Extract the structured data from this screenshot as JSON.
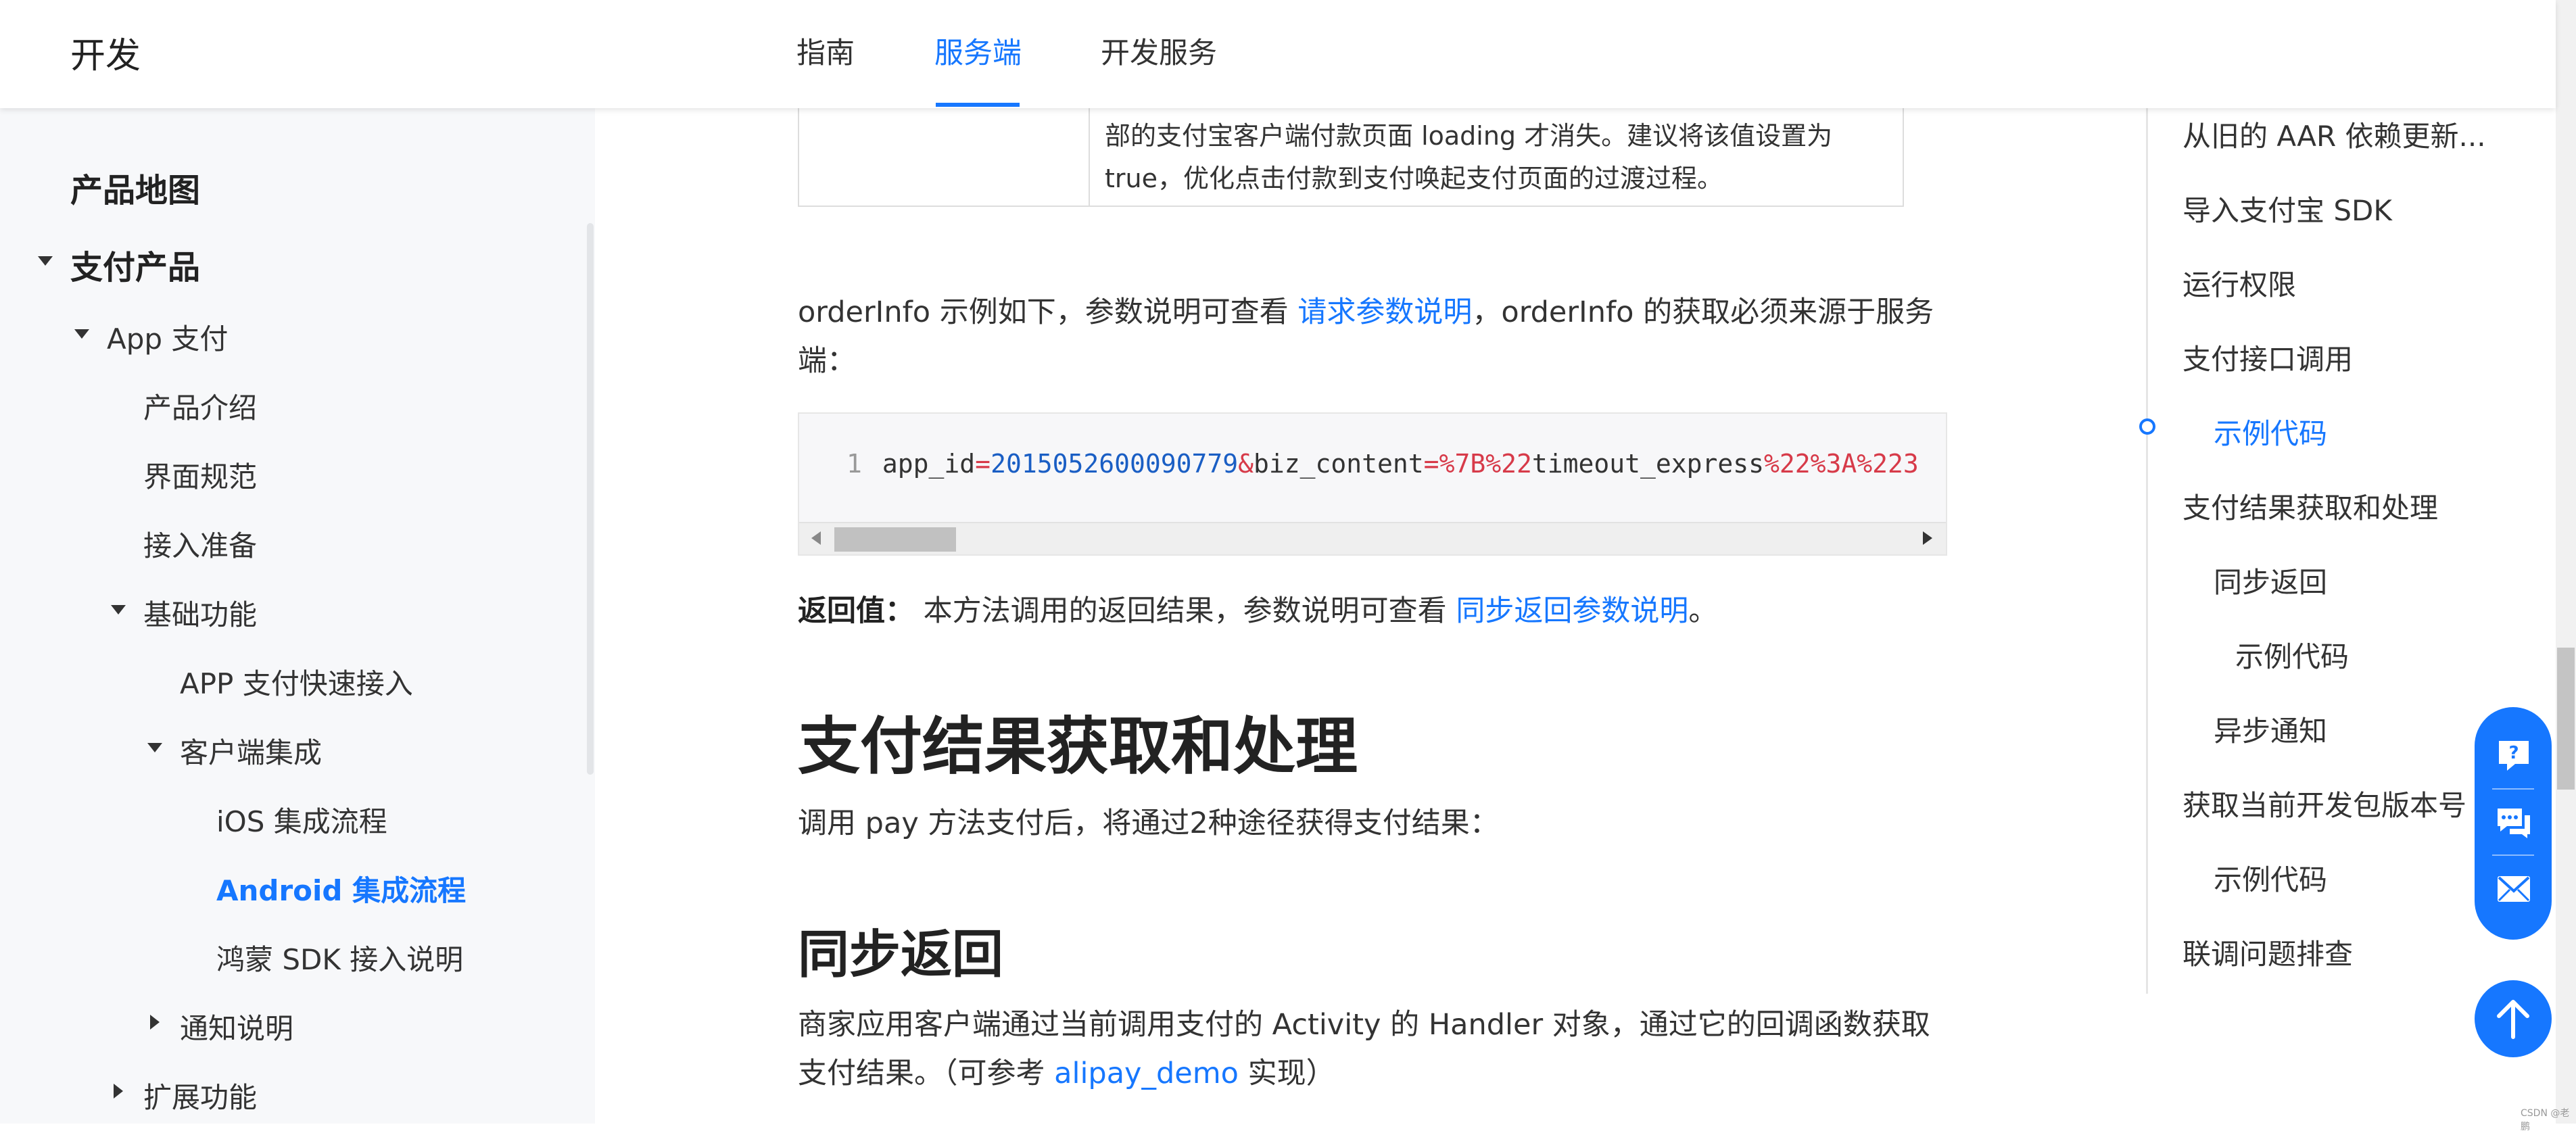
{
  "header": {
    "brand": "开发",
    "tabs": [
      {
        "label": "指南"
      },
      {
        "label": "服务端",
        "active": true
      },
      {
        "label": "开发服务"
      }
    ]
  },
  "sidebar": {
    "product_map": "产品地图",
    "payment_products": "支付产品",
    "app_pay": "App 支付",
    "product_intro": "产品介绍",
    "ui_spec": "界面规范",
    "integration_prep": "接入准备",
    "basic_functions": "基础功能",
    "app_quick_access": "APP 支付快速接入",
    "client_integration": "客户端集成",
    "ios_flow": "iOS 集成流程",
    "android_flow": "Android 集成流程",
    "harmony_sdk": "鸿蒙 SDK 接入说明",
    "notification": "通知说明",
    "extended_functions": "扩展功能"
  },
  "main": {
    "table_desc": "部的支付宝客户端付款页面 loading 才消失。建议将该值设置为 true，优化点击付款到支付唤起支付页面的过渡过程。",
    "orderinfo_intro_a": "orderInfo 示例如下，参数说明可查看 ",
    "orderinfo_link": "请求参数说明",
    "orderinfo_intro_b": "，orderInfo 的获取必须来源于服务端：",
    "code": {
      "line_number": "1",
      "t1": "app_id",
      "t2": "=",
      "t3": "2015052600090779",
      "t4": "&",
      "t5": "biz_content",
      "t6": "=",
      "t7": "%7B",
      "t8": "%22",
      "t9": "timeout_express",
      "t10": "%22",
      "t11": "%3A",
      "t12": "%223"
    },
    "return_label": "返回值：",
    "return_text": " 本方法调用的返回结果，参数说明可查看 ",
    "return_link": "同步返回参数说明",
    "return_end": "。",
    "h2_result": "支付结果获取和处理",
    "result_desc": "调用 pay 方法支付后，将通过2种途径获得支付结果：",
    "h3_sync": "同步返回",
    "sync_desc_a": "商家应用客户端通过当前调用支付的 Activity 的 Handler 对象，通过它的回调函数获取支付结果。（可参考 ",
    "sync_link": "alipay_demo",
    "sync_desc_b": " 实现）"
  },
  "toc": [
    {
      "label": "从旧的 AAR 依赖更新..."
    },
    {
      "label": "导入支付宝 SDK"
    },
    {
      "label": "运行权限"
    },
    {
      "label": "支付接口调用"
    },
    {
      "label": "示例代码",
      "active": true
    },
    {
      "label": "支付结果获取和处理"
    },
    {
      "label": "同步返回"
    },
    {
      "label": "示例代码"
    },
    {
      "label": "异步通知"
    },
    {
      "label": "获取当前开发包版本号"
    },
    {
      "label": "示例代码"
    },
    {
      "label": "联调问题排查"
    }
  ],
  "floating": {
    "icons": [
      "help-icon",
      "chat-icon",
      "feedback-mail-icon",
      "arrow-up-icon"
    ]
  },
  "watermark": "CSDN @老鹏",
  "colors": {
    "accent": "#1677ff",
    "code_number": "#1a5ec4",
    "code_operator": "#d73a49"
  }
}
